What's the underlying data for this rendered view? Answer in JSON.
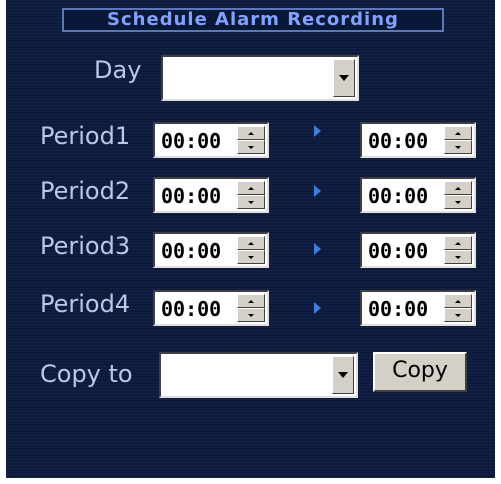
{
  "title": "Schedule Alarm Recording",
  "day": {
    "label": "Day",
    "value": ""
  },
  "periods": [
    {
      "label": "Period1",
      "start": "00:00",
      "end": "00:00"
    },
    {
      "label": "Period2",
      "start": "00:00",
      "end": "00:00"
    },
    {
      "label": "Period3",
      "start": "00:00",
      "end": "00:00"
    },
    {
      "label": "Period4",
      "start": "00:00",
      "end": "00:00"
    }
  ],
  "copy_to": {
    "label": "Copy to",
    "value": ""
  },
  "copy_button": "Copy",
  "colors": {
    "panel_bg": "#0b1a3d",
    "title": "#7fa3ff",
    "label": "#b8c9e6",
    "arrow": "#3d7fe0"
  }
}
